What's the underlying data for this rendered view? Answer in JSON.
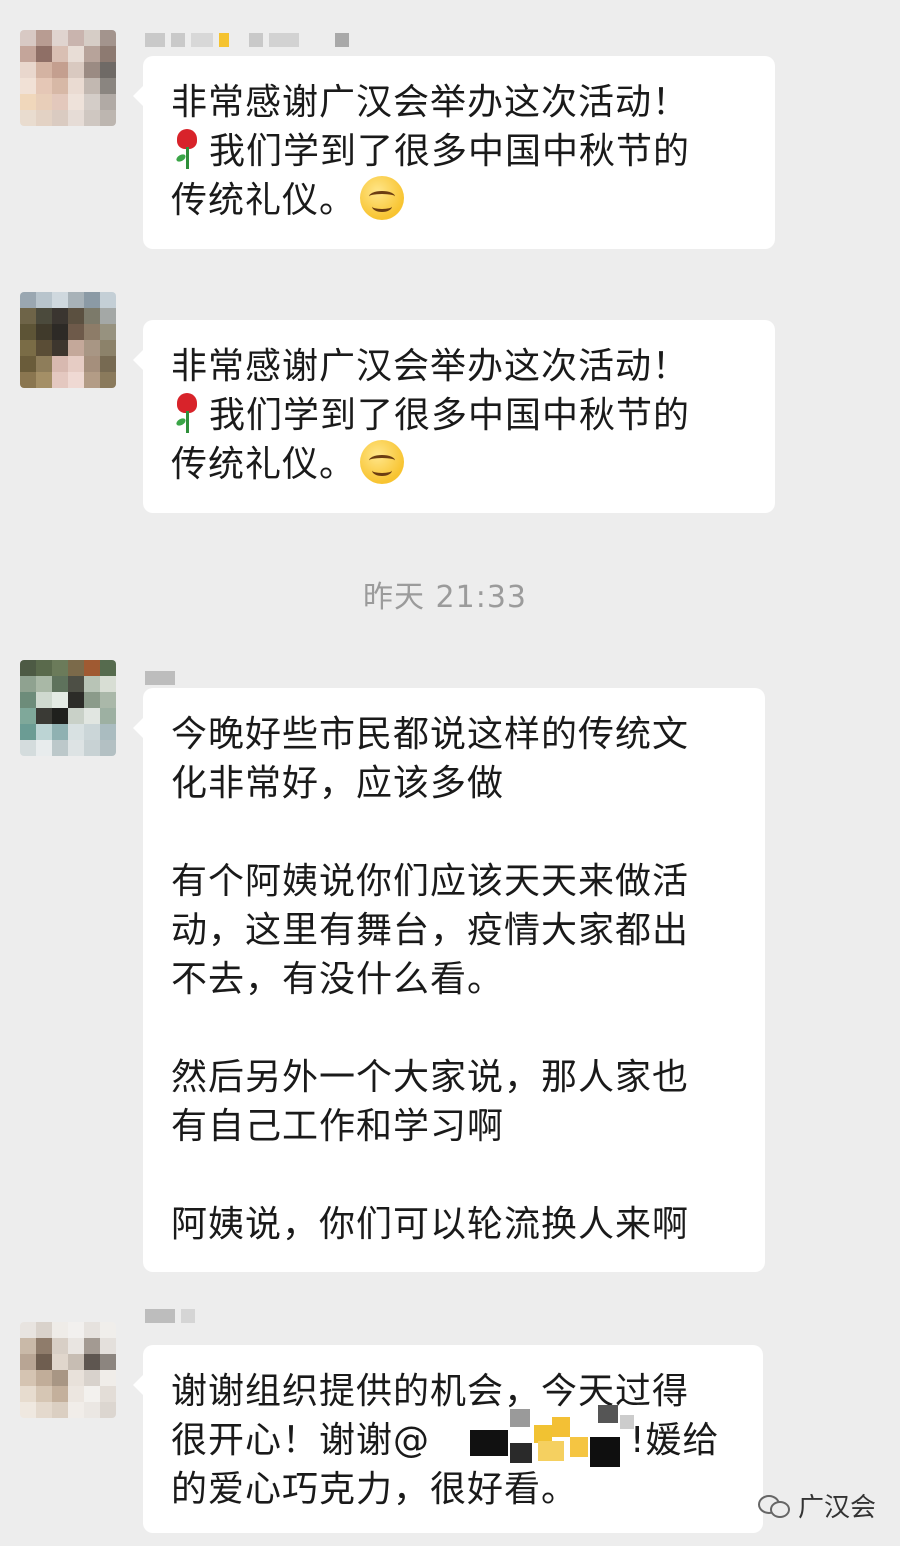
{
  "messages": [
    {
      "id": "m1",
      "lines": [
        "非常感谢广汉会举办这次活动！",
        "我们学到了很多中国中秋节的",
        "传统礼仪。"
      ]
    },
    {
      "id": "m2",
      "lines": [
        "非常感谢广汉会举办这次活动！",
        "我们学到了很多中国中秋节的",
        "传统礼仪。"
      ]
    },
    {
      "id": "m3",
      "paragraphs": [
        "今晚好些市民都说这样的传统文\n化非常好，应该多做",
        "有个阿姨说你们应该天天来做活\n动，这里有舞台，疫情大家都出\n不去，有没什么看。",
        "然后另外一个大家说，那人家也\n有自己工作和学习啊",
        "阿姨说，你们可以轮流换人来啊"
      ]
    },
    {
      "id": "m4",
      "lines": [
        "谢谢组织提供的机会，今天过得",
        "很开心！谢谢@",
        "的爱心巧克力，很好看。"
      ],
      "tail_segment": "!媛给"
    }
  ],
  "timestamp": "昨天 21:33",
  "watermark": {
    "text": "广汉会",
    "icon": "wechat-official-account-icon"
  },
  "emoji": {
    "rose": "rose-emoji",
    "smile": "smiling-face-emoji"
  },
  "colors": {
    "background": "#ededed",
    "bubble": "#ffffff",
    "text": "#1a1a1a",
    "timestamp": "#9b9b9b"
  }
}
